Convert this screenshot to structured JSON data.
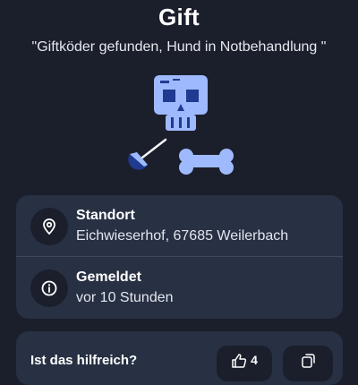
{
  "header": {
    "title": "Gift",
    "subtitle": "\"Giftköder gefunden, Hund in Notbehandlung \""
  },
  "details": {
    "location": {
      "label": "Standort",
      "value": "Eichwieserhof, 67685 Weilerbach",
      "icon": "location-pin-icon"
    },
    "reported": {
      "label": "Gemeldet",
      "value": "vor 10 Stunden",
      "icon": "info-icon"
    }
  },
  "help": {
    "title": "Ist das hilfreich?",
    "like_count": "4",
    "like_icon": "thumbs-up-icon",
    "share_icon": "share-icon"
  },
  "colors": {
    "background": "#1b1f2c",
    "card": "#283043",
    "illustration_light": "#9fb9ff",
    "illustration_dark": "#1f3b8f"
  }
}
